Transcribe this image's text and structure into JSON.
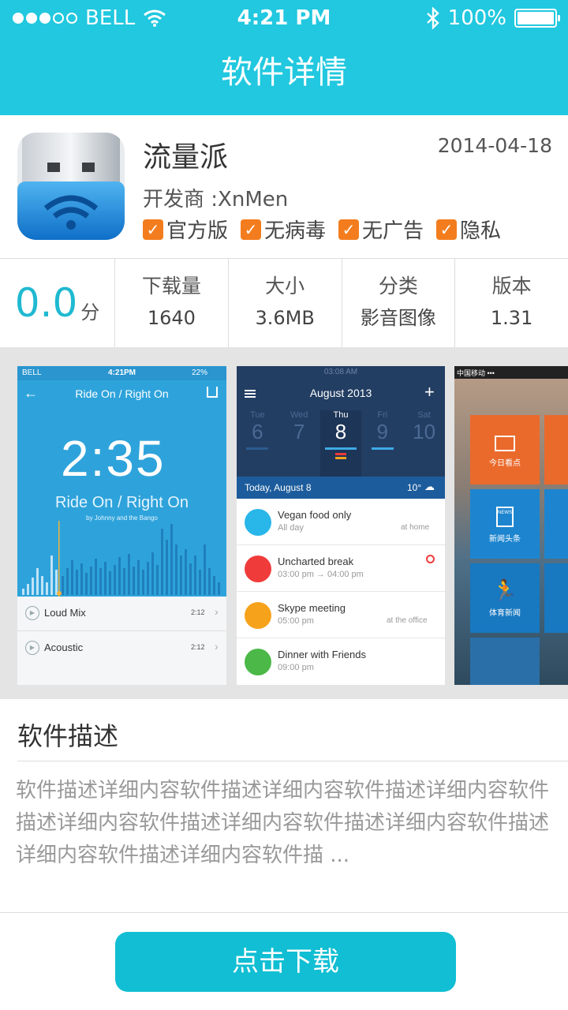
{
  "status_bar": {
    "carrier": "BELL",
    "time": "4:21 PM",
    "battery": "100%"
  },
  "header": {
    "title": "软件详情"
  },
  "app": {
    "name": "流量派",
    "date": "2014-04-18",
    "developer": "开发商 :XnMen",
    "badges": [
      "官方版",
      "无病毒",
      "无广告",
      "隐私"
    ]
  },
  "stats": {
    "score": "0.0",
    "score_unit": "分",
    "items": [
      {
        "label": "下载量",
        "value": "1640"
      },
      {
        "label": "大小",
        "value": "3.6MB"
      },
      {
        "label": "分类",
        "value": "影音图像"
      },
      {
        "label": "版本",
        "value": "1.31"
      }
    ]
  },
  "screenshots": {
    "s1": {
      "carrier": "BELL",
      "time": "4:21PM",
      "battery": "22%",
      "title": "Ride On / Right On",
      "clock": "2:35",
      "song": "Ride On / Right On",
      "artist": "by Johnny and the Bango",
      "tracks": [
        {
          "name": "Loud Mix",
          "dur": "2:12"
        },
        {
          "name": "Acoustic",
          "dur": "2:12"
        }
      ]
    },
    "s2": {
      "status_time": "03:08 AM",
      "month": "August 2013",
      "days": [
        {
          "d": "Tue",
          "n": "6"
        },
        {
          "d": "Wed",
          "n": "7"
        },
        {
          "d": "Thu",
          "n": "8"
        },
        {
          "d": "Fri",
          "n": "9"
        },
        {
          "d": "Sat",
          "n": "10"
        }
      ],
      "today": "Today, August 8",
      "temp": "10°",
      "events": [
        {
          "title": "Vegan food only",
          "time": "All day",
          "place": "at home",
          "color": "#29b6e8"
        },
        {
          "title": "Uncharted break",
          "time": "03:00 pm → 04:00 pm",
          "place": "",
          "color": "#f03b3b"
        },
        {
          "title": "Skype meeting",
          "time": "05:00 pm",
          "place": "at the office",
          "color": "#f7a21b"
        },
        {
          "title": "Dinner with Friends",
          "time": "09:00 pm",
          "place": "",
          "color": "#4bb848"
        }
      ]
    },
    "s3": {
      "carrier": "中国移动 •••",
      "tiles": [
        "今日看点",
        "新闻头条",
        "体育新闻"
      ]
    }
  },
  "description": {
    "title": "软件描述",
    "text": "软件描述详细内容软件描述详细内容软件描述详细内容软件描述详细内容软件描述详细内容软件描述详细内容软件描述详细内容软件描述详细内容软件描 ..."
  },
  "download": {
    "label": "点击下载"
  },
  "colors": {
    "primary": "#21c8df",
    "accent": "#f37d1e"
  }
}
